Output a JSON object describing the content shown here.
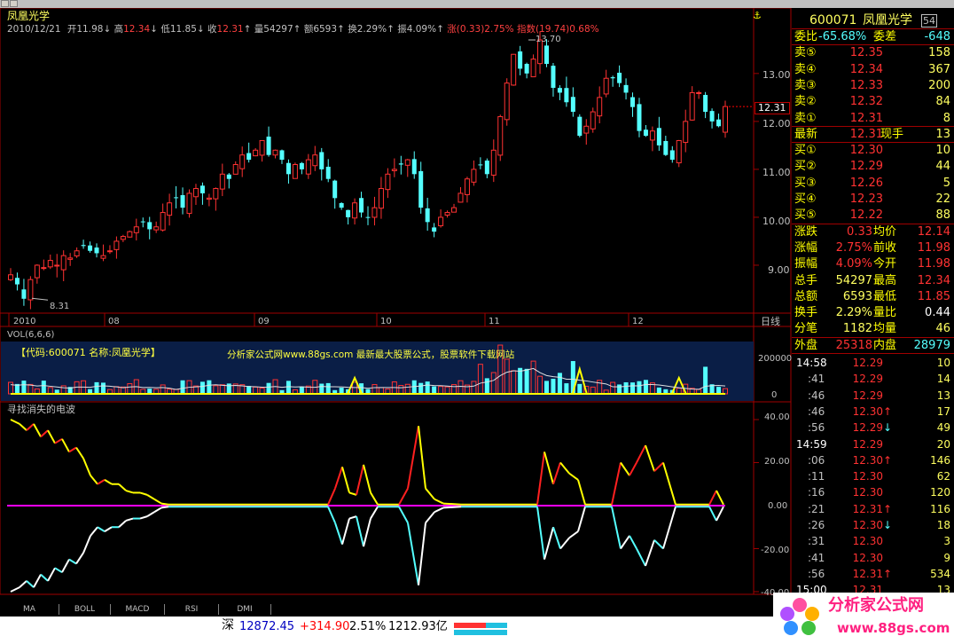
{
  "window": {
    "title": "凤凰光学"
  },
  "kline": {
    "info": {
      "date": "2010/12/21",
      "open_label": "开",
      "open": "11.98",
      "high_label": "高",
      "high": "12.34",
      "low_label": "低",
      "low": "11.85",
      "close_label": "收",
      "close": "12.31",
      "vol_label": "量",
      "vol": "54297",
      "amt_label": "额",
      "amt": "6593",
      "turn_label": "换",
      "turn": "2.29%",
      "amp_label": "振",
      "amp": "4.09%",
      "chg_label": "涨",
      "chg": "(0.33)2.75%",
      "idx_label": "指数",
      "idx": "(19.74)0.68%"
    },
    "max_label": "13.70",
    "min_label": "8.31",
    "price_axis": [
      "13.00",
      "12.00",
      "11.00",
      "10.00",
      "9.00"
    ],
    "current_price_tag": "12.31",
    "date_axis": [
      "2010",
      "08",
      "09",
      "10",
      "11",
      "12"
    ],
    "period": "日线"
  },
  "volume": {
    "label": "VOL(6,6,6)",
    "axis": [
      "200000",
      "0"
    ],
    "watermark_code": "【代码:600071 名称:凤凰光学】",
    "watermark_site": "分析家公式网www.88gs.com 最新最大股票公式，股票软件下载网站"
  },
  "indicator": {
    "label": "寻找消失的电波",
    "axis": [
      "40.00",
      "20.00",
      "0.00",
      "-20.00",
      "-40.00"
    ]
  },
  "tabs": [
    "MA",
    "BOLL",
    "MACD",
    "RSI",
    "DMI"
  ],
  "quote": {
    "code": "600071",
    "name": "凤凰光学",
    "badge": "54",
    "weibi_label": "委比",
    "weibi": "-65.68%",
    "weicha_label": "委差",
    "weicha": "-648",
    "sells": [
      {
        "label": "卖⑤",
        "price": "12.35",
        "vol": "158"
      },
      {
        "label": "卖④",
        "price": "12.34",
        "vol": "367"
      },
      {
        "label": "卖③",
        "price": "12.33",
        "vol": "200"
      },
      {
        "label": "卖②",
        "price": "12.32",
        "vol": "84"
      },
      {
        "label": "卖①",
        "price": "12.31",
        "vol": "8"
      }
    ],
    "latest_label": "最新",
    "latest": "12.31",
    "xianshou_label": "现手",
    "xianshou": "13",
    "buys": [
      {
        "label": "买①",
        "price": "12.30",
        "vol": "10"
      },
      {
        "label": "买②",
        "price": "12.29",
        "vol": "44"
      },
      {
        "label": "买③",
        "price": "12.26",
        "vol": "5"
      },
      {
        "label": "买④",
        "price": "12.23",
        "vol": "22"
      },
      {
        "label": "买⑤",
        "price": "12.22",
        "vol": "88"
      }
    ],
    "stats": [
      {
        "l1": "涨跌",
        "v1": "0.33",
        "l2": "均价",
        "v2": "12.14"
      },
      {
        "l1": "涨幅",
        "v1": "2.75%",
        "l2": "前收",
        "v2": "11.98"
      },
      {
        "l1": "振幅",
        "v1": "4.09%",
        "l2": "今开",
        "v2": "11.98"
      },
      {
        "l1": "总手",
        "v1": "54297",
        "l2": "最高",
        "v2": "12.34"
      },
      {
        "l1": "总额",
        "v1": "6593",
        "l2": "最低",
        "v2": "11.85"
      },
      {
        "l1": "换手",
        "v1": "2.29%",
        "l2": "量比",
        "v2": "0.44"
      },
      {
        "l1": "分笔",
        "v1": "1182",
        "l2": "均量",
        "v2": "46"
      }
    ],
    "waipan_label": "外盘",
    "waipan": "25318",
    "neipan_label": "内盘",
    "neipan": "28979",
    "ticks": [
      {
        "t": "14:58",
        "p": "12.29",
        "v": "10",
        "d": ""
      },
      {
        "t": ":41",
        "p": "12.29",
        "v": "14",
        "d": ""
      },
      {
        "t": ":46",
        "p": "12.29",
        "v": "13",
        "d": ""
      },
      {
        "t": ":46",
        "p": "12.30",
        "v": "17",
        "d": "up"
      },
      {
        "t": ":56",
        "p": "12.29",
        "v": "49",
        "d": "down"
      },
      {
        "t": "14:59",
        "p": "12.29",
        "v": "20",
        "d": ""
      },
      {
        "t": ":06",
        "p": "12.30",
        "v": "146",
        "d": "up"
      },
      {
        "t": ":11",
        "p": "12.30",
        "v": "62",
        "d": ""
      },
      {
        "t": ":16",
        "p": "12.30",
        "v": "120",
        "d": ""
      },
      {
        "t": ":21",
        "p": "12.31",
        "v": "116",
        "d": "up"
      },
      {
        "t": ":26",
        "p": "12.30",
        "v": "18",
        "d": "down"
      },
      {
        "t": ":31",
        "p": "12.30",
        "v": "3",
        "d": ""
      },
      {
        "t": ":41",
        "p": "12.30",
        "v": "9",
        "d": ""
      },
      {
        "t": ":56",
        "p": "12.31",
        "v": "534",
        "d": "up"
      },
      {
        "t": "15:00",
        "p": "12.31",
        "v": "13",
        "d": ""
      }
    ]
  },
  "status": {
    "market": "深",
    "index": "12872.45",
    "change": "+314.90",
    "pct": "2.51%",
    "amount": "1212.93亿"
  },
  "logo": {
    "text": "分析家公式网",
    "url": "www.88gs.com"
  },
  "colors": {
    "up": "#ff3232",
    "down": "#54ffff",
    "yellow": "#ffff00",
    "magenta": "#ff00ff",
    "grid": "#a00000",
    "label": "#c0c0c0",
    "volbg": "#0a1e46"
  },
  "chart_data": [
    {
      "type": "candlestick",
      "title": "凤凰光学",
      "period": "日线",
      "ylim": [
        8.0,
        14.2
      ],
      "y_ticks": [
        9.0,
        10.0,
        11.0,
        12.0,
        13.0
      ],
      "x_tick_labels": [
        "2010",
        "08",
        "09",
        "10",
        "11",
        "12"
      ],
      "high_marker": 13.7,
      "low_marker": 8.31,
      "close_series": [
        8.8,
        8.6,
        8.3,
        8.7,
        9.0,
        8.95,
        9.1,
        9.0,
        9.2,
        9.15,
        9.3,
        9.4,
        9.3,
        9.25,
        9.2,
        9.3,
        9.5,
        9.6,
        9.7,
        9.8,
        9.9,
        9.75,
        9.8,
        10.1,
        10.3,
        10.4,
        10.2,
        10.5,
        10.6,
        10.5,
        10.4,
        10.6,
        10.9,
        10.8,
        11.1,
        11.3,
        11.2,
        11.4,
        11.6,
        11.3,
        11.4,
        11.2,
        10.9,
        11.1,
        11.0,
        11.2,
        11.3,
        11.0,
        10.8,
        10.4,
        10.2,
        10.0,
        10.3,
        10.1,
        10.0,
        10.2,
        10.6,
        10.9,
        11.0,
        11.1,
        11.2,
        10.9,
        10.2,
        9.9,
        9.7,
        10.0,
        10.1,
        10.2,
        10.5,
        10.8,
        11.0,
        11.1,
        10.9,
        11.4,
        12.1,
        12.8,
        13.4,
        13.1,
        13.0,
        13.3,
        13.7,
        13.2,
        12.7,
        12.6,
        12.4,
        12.2,
        11.7,
        11.9,
        12.2,
        12.5,
        12.9,
        12.9,
        12.8,
        12.6,
        12.3,
        11.8,
        11.7,
        11.8,
        11.5,
        11.3,
        11.2,
        11.6,
        12.0,
        12.6,
        12.6,
        12.2,
        12.0,
        11.9,
        12.31
      ]
    },
    {
      "type": "bar",
      "title": "VOL(6,6,6)",
      "ylim": [
        0,
        280000
      ],
      "y_ticks": [
        0,
        200000
      ]
    },
    {
      "type": "line",
      "title": "寻找消失的电波",
      "ylim": [
        -40,
        40
      ],
      "y_ticks": [
        -40,
        -20,
        0,
        20,
        40
      ]
    }
  ]
}
